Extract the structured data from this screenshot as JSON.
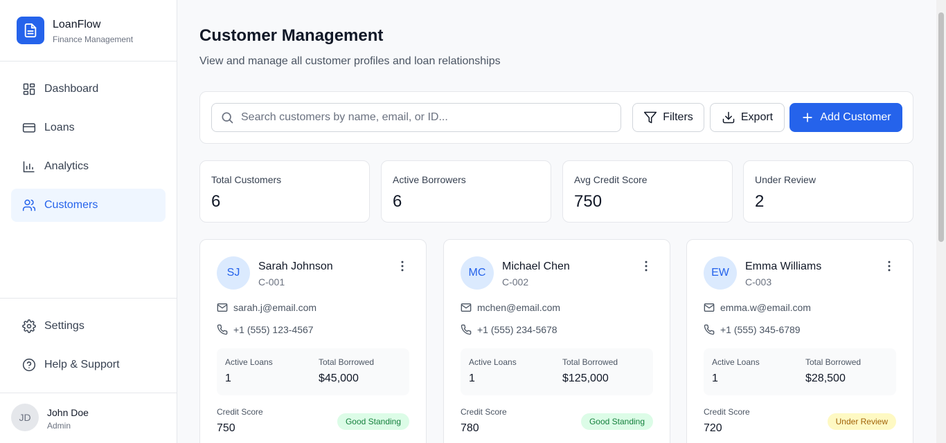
{
  "brand": {
    "name": "LoanFlow",
    "subtitle": "Finance Management"
  },
  "nav": {
    "items": [
      {
        "label": "Dashboard",
        "icon": "dashboard-icon",
        "active": false
      },
      {
        "label": "Loans",
        "icon": "credit-card-icon",
        "active": false
      },
      {
        "label": "Analytics",
        "icon": "bar-chart-icon",
        "active": false
      },
      {
        "label": "Customers",
        "icon": "users-icon",
        "active": true
      }
    ],
    "bottom": [
      {
        "label": "Settings",
        "icon": "gear-icon"
      },
      {
        "label": "Help & Support",
        "icon": "help-circle-icon"
      }
    ]
  },
  "user": {
    "initials": "JD",
    "name": "John Doe",
    "role": "Admin"
  },
  "header": {
    "title": "Customer Management",
    "subtitle": "View and manage all customer profiles and loan relationships"
  },
  "toolbar": {
    "search_placeholder": "Search customers by name, email, or ID...",
    "filters_label": "Filters",
    "export_label": "Export",
    "add_label": "Add Customer"
  },
  "stats": [
    {
      "label": "Total Customers",
      "value": "6"
    },
    {
      "label": "Active Borrowers",
      "value": "6"
    },
    {
      "label": "Avg Credit Score",
      "value": "750"
    },
    {
      "label": "Under Review",
      "value": "2"
    }
  ],
  "labels": {
    "active_loans": "Active Loans",
    "total_borrowed": "Total Borrowed",
    "credit_score": "Credit Score"
  },
  "customers": [
    {
      "initials": "SJ",
      "name": "Sarah Johnson",
      "id": "C-001",
      "email": "sarah.j@email.com",
      "phone": "+1 (555) 123-4567",
      "active_loans": "1",
      "total_borrowed": "$45,000",
      "credit_score": "750",
      "status": "Good Standing"
    },
    {
      "initials": "MC",
      "name": "Michael Chen",
      "id": "C-002",
      "email": "mchen@email.com",
      "phone": "+1 (555) 234-5678",
      "active_loans": "1",
      "total_borrowed": "$125,000",
      "credit_score": "780",
      "status": "Good Standing"
    },
    {
      "initials": "EW",
      "name": "Emma Williams",
      "id": "C-003",
      "email": "emma.w@email.com",
      "phone": "+1 (555) 345-6789",
      "active_loans": "1",
      "total_borrowed": "$28,500",
      "credit_score": "720",
      "status": "Under Review"
    }
  ],
  "colors": {
    "accent": "#2563eb",
    "good": "#15803d",
    "review": "#a16207"
  }
}
